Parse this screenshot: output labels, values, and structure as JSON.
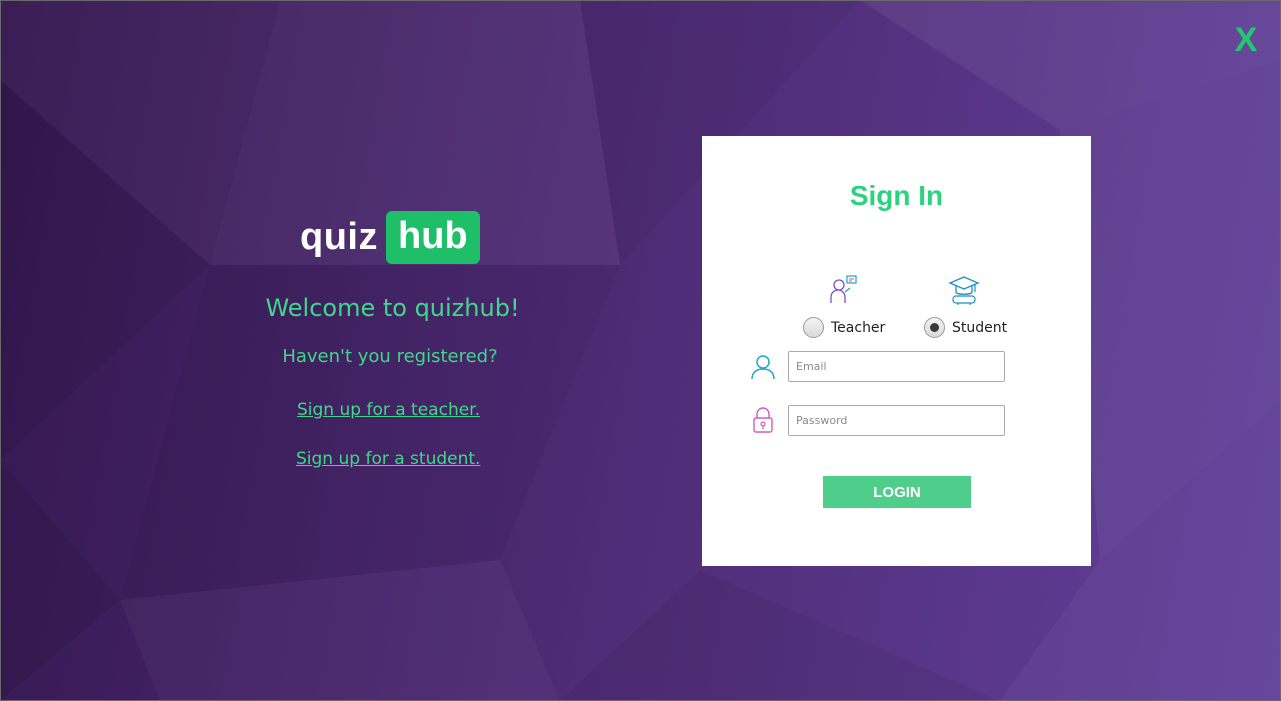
{
  "window": {
    "close_label": "X"
  },
  "brand": {
    "logo_part1": "quiz",
    "logo_part2": "hub",
    "welcome": "Welcome to quizhub!",
    "registered_prompt": "Haven't you registered?",
    "signup_teacher": "Sign up for a teacher.",
    "signup_student": "Sign up for a student."
  },
  "signin": {
    "title": "Sign In",
    "roles": [
      {
        "label": "Teacher",
        "icon": "teacher-icon",
        "selected": false
      },
      {
        "label": "Student",
        "icon": "graduate-icon",
        "selected": true
      }
    ],
    "email": {
      "value": "",
      "placeholder": "Email",
      "icon": "user-icon"
    },
    "password": {
      "value": "",
      "placeholder": "Password",
      "icon": "lock-icon"
    },
    "login_label": "LOGIN"
  },
  "colors": {
    "accent_green": "#2bd37f",
    "button_green": "#4ece8a",
    "logo_badge": "#1fbf6a",
    "background": "#452468"
  }
}
